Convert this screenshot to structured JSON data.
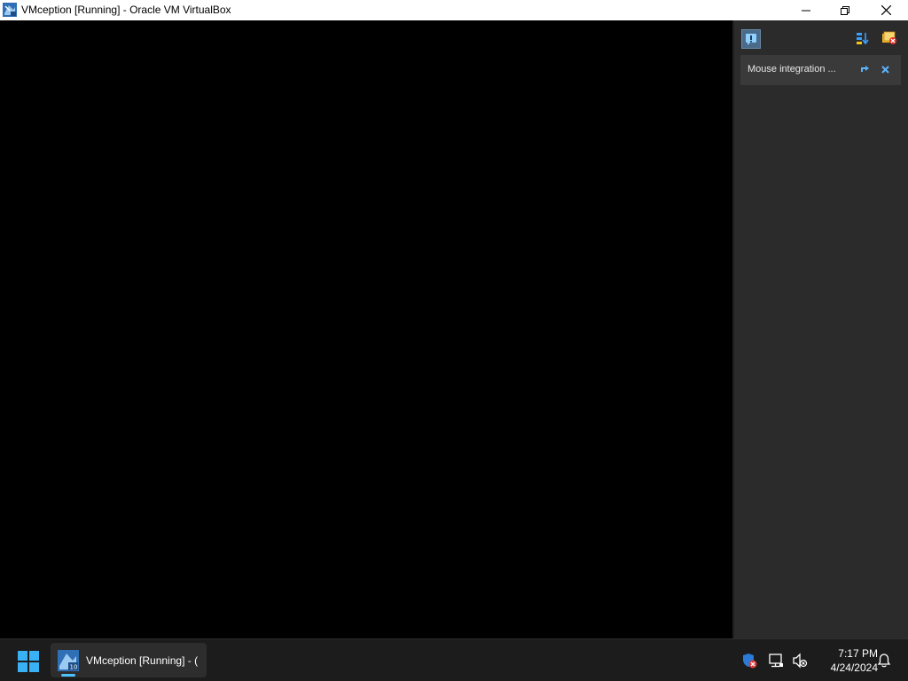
{
  "window": {
    "title": "VMception [Running] - Oracle VM VirtualBox",
    "controls": {
      "minimize": "minimize-icon",
      "restore": "restore-icon",
      "close": "close-icon"
    }
  },
  "notification_center": {
    "toggle_icon": "notification-center-icon",
    "sort_icon": "sort-icon",
    "clear_all_icon": "clear-all-icon",
    "items": [
      {
        "text": "Mouse integration ...",
        "actions": [
          "pin-icon",
          "close-icon"
        ]
      }
    ]
  },
  "taskbar": {
    "start_icon": "windows-start-icon",
    "apps": [
      {
        "label": "VMception [Running] - (",
        "icon": "virtualbox-vm-icon",
        "active": true
      }
    ],
    "tray": {
      "icons": [
        "security-warning-icon",
        "network-icon",
        "volume-muted-icon"
      ],
      "time": "7:17 PM",
      "date": "4/24/2024",
      "notification_icon": "bell-icon"
    }
  },
  "colors": {
    "taskbar_bg": "#1c1c1c",
    "panel_bg": "#2b2b2b",
    "accent": "#4cc2ff",
    "titlebar_bg": "#ffffff"
  }
}
